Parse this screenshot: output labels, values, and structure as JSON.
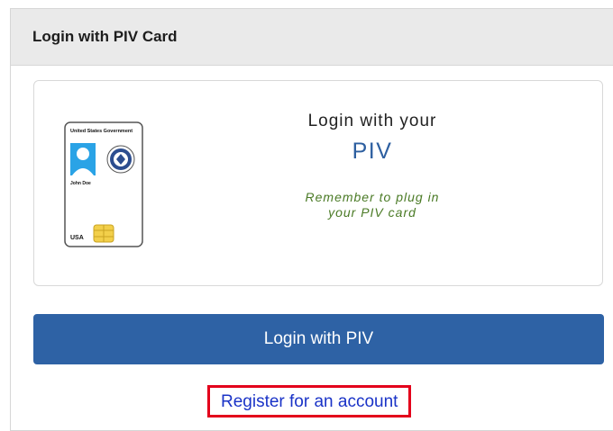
{
  "panel": {
    "header_title": "Login with PIV Card"
  },
  "card_box": {
    "line1": "Login with your",
    "line2": "PIV",
    "reminder": "Remember to plug in\nyour PIV card",
    "card_image": {
      "icon": "piv-card-icon",
      "header_text": "United States Government",
      "name_text": "John Doe",
      "country_text": "USA"
    }
  },
  "login_button": {
    "label": "Login with PIV"
  },
  "register_link": {
    "label": "Register for an account"
  },
  "colors": {
    "header_bg": "#eaeaea",
    "button_bg": "#2e62a5",
    "piv_blue": "#2d5fa0",
    "reminder_green": "#4a7a25",
    "link_blue": "#1a33c7",
    "highlight_red": "#e3001b"
  }
}
